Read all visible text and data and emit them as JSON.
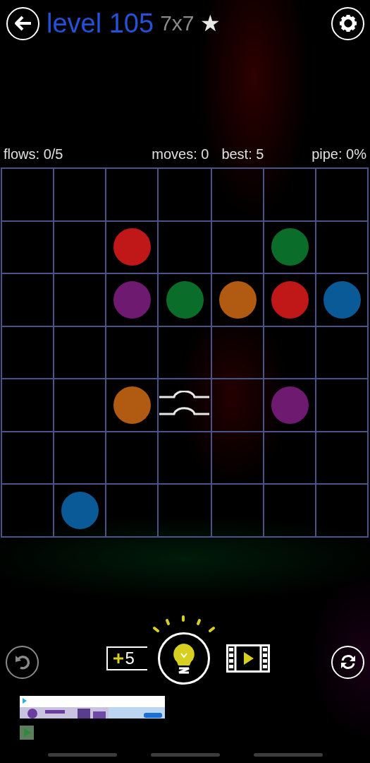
{
  "header": {
    "title": "level 105",
    "size": "7x7",
    "star": "★"
  },
  "stats": {
    "flows": "flows: 0/5",
    "moves": "moves: 0",
    "best": "best: 5",
    "pipe": "pipe: 0%"
  },
  "board": {
    "rows": [
      [
        {
          "kind": "empty"
        },
        {
          "kind": "empty"
        },
        {
          "kind": "empty"
        },
        {
          "kind": "empty"
        },
        {
          "kind": "empty"
        },
        {
          "kind": "empty"
        },
        {
          "kind": "empty"
        }
      ],
      [
        {
          "kind": "empty"
        },
        {
          "kind": "empty"
        },
        {
          "kind": "dot",
          "color": "#c01818"
        },
        {
          "kind": "empty"
        },
        {
          "kind": "empty"
        },
        {
          "kind": "dot",
          "color": "#0a6e2a"
        },
        {
          "kind": "empty"
        }
      ],
      [
        {
          "kind": "empty"
        },
        {
          "kind": "empty"
        },
        {
          "kind": "dot",
          "color": "#6e1a70"
        },
        {
          "kind": "dot",
          "color": "#0a6e2a"
        },
        {
          "kind": "dot",
          "color": "#b05a12"
        },
        {
          "kind": "dot",
          "color": "#c01818"
        },
        {
          "kind": "dot",
          "color": "#0a5a98"
        }
      ],
      [
        {
          "kind": "empty"
        },
        {
          "kind": "empty"
        },
        {
          "kind": "empty"
        },
        {
          "kind": "empty"
        },
        {
          "kind": "empty"
        },
        {
          "kind": "empty"
        },
        {
          "kind": "empty"
        }
      ],
      [
        {
          "kind": "empty"
        },
        {
          "kind": "empty"
        },
        {
          "kind": "dot",
          "color": "#b05a12"
        },
        {
          "kind": "bridge"
        },
        {
          "kind": "empty"
        },
        {
          "kind": "dot",
          "color": "#6e1a70"
        },
        {
          "kind": "empty"
        }
      ],
      [
        {
          "kind": "empty"
        },
        {
          "kind": "empty"
        },
        {
          "kind": "empty"
        },
        {
          "kind": "empty"
        },
        {
          "kind": "empty"
        },
        {
          "kind": "empty"
        },
        {
          "kind": "empty"
        }
      ],
      [
        {
          "kind": "empty"
        },
        {
          "kind": "dot",
          "color": "#0a5a98"
        },
        {
          "kind": "empty"
        },
        {
          "kind": "empty"
        },
        {
          "kind": "empty"
        },
        {
          "kind": "empty"
        },
        {
          "kind": "empty"
        }
      ]
    ]
  },
  "hints": {
    "count": "5"
  }
}
